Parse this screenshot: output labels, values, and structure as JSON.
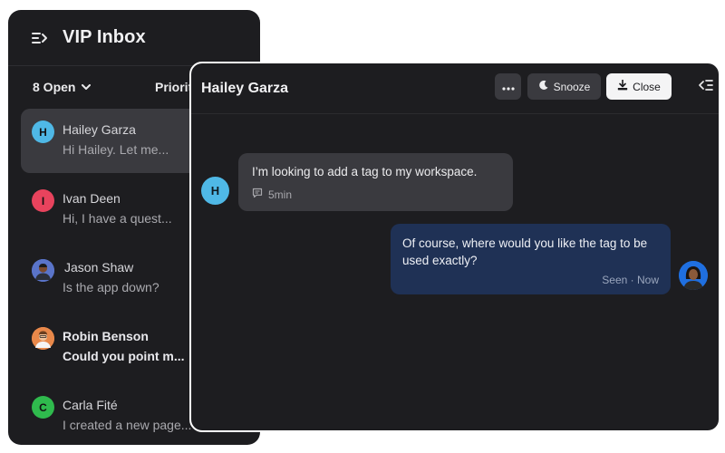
{
  "inbox": {
    "title": "VIP Inbox",
    "open_filter": "8 Open",
    "sort_filter": "Priority",
    "conversations": [
      {
        "initial": "H",
        "name": "Hailey Garza",
        "preview": "Hi Hailey. Let me...",
        "avatar_color": "#4fb8e6",
        "active": true,
        "unread": false
      },
      {
        "initial": "I",
        "name": "Ivan Deen",
        "preview": "Hi, I have a quest...",
        "avatar_color": "#e8435d",
        "active": false,
        "unread": false
      },
      {
        "initial": "",
        "name": "Jason Shaw",
        "preview": "Is the app down?",
        "avatar_color": "#5a74c9",
        "active": false,
        "unread": false
      },
      {
        "initial": "",
        "name": "Robin Benson",
        "preview": "Could you point m...",
        "avatar_color": "#e8884a",
        "active": false,
        "unread": true
      },
      {
        "initial": "C",
        "name": "Carla Fité",
        "preview": "I created a new page...",
        "avatar_color": "#2fba4d",
        "active": false,
        "unread": false
      }
    ]
  },
  "conversation": {
    "title": "Hailey Garza",
    "more_label": "···",
    "snooze_label": "Snooze",
    "close_label": "Close",
    "customer_initial": "H",
    "messages": {
      "incoming_text": "I’m looking to add a tag to my workspace.",
      "incoming_meta": "5min",
      "outgoing_text": "Of course, where would you like the tag to be used exactly?",
      "outgoing_meta": "Seen · Now"
    }
  },
  "colors": {
    "panel_bg": "#1d1d20",
    "active_item": "#3a3a3f",
    "outgoing_bubble": "#1f3155",
    "incoming_bubble": "#3a3a3f"
  },
  "icons": {
    "menu": "menu-collapse-icon",
    "chevron": "chevron-down-icon",
    "more": "more-horizontal-icon",
    "snooze": "moon-icon",
    "close": "archive-download-icon",
    "collapse": "collapse-panel-icon",
    "comment": "comment-icon"
  }
}
